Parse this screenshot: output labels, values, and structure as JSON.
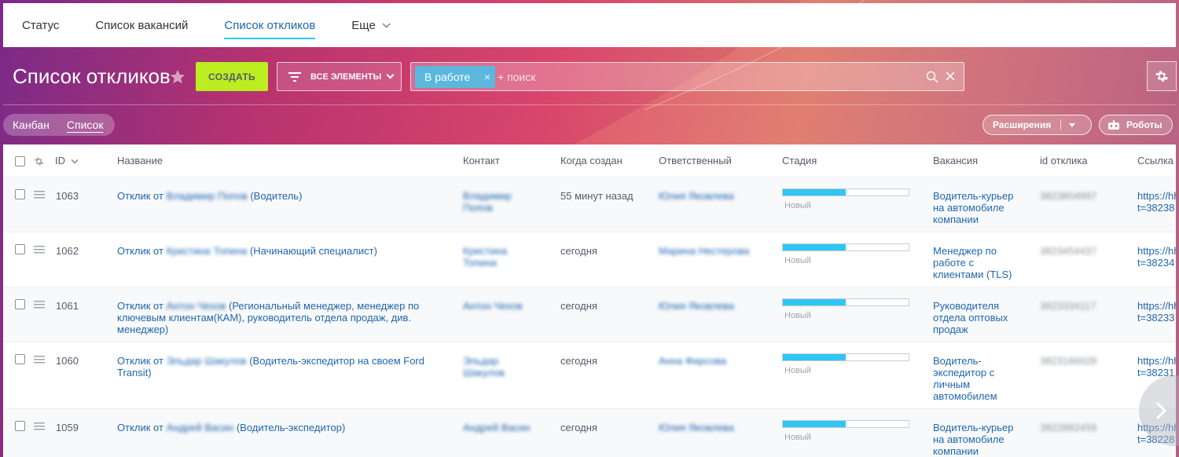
{
  "tabs": [
    {
      "label": "Статус"
    },
    {
      "label": "Список вакансий"
    },
    {
      "label": "Список откликов"
    },
    {
      "label": "Еще"
    }
  ],
  "page_title": "Список откликов",
  "toolbar": {
    "create_label": "СОЗДАТЬ",
    "filter_label": "ВСЕ ЭЛЕМЕНТЫ",
    "chip_label": "В работе",
    "chip_close": "×",
    "search_placeholder": "+ поиск"
  },
  "view_toggle": {
    "kanban": "Канбан",
    "list": "Список"
  },
  "extensions_label": "Расширения",
  "robots_label": "Роботы",
  "columns": {
    "id": "ID",
    "name": "Название",
    "contact": "Контакт",
    "created": "Когда создан",
    "responsible": "Ответственный",
    "stage": "Стадия",
    "vacancy": "Вакансия",
    "response_id": "id отклика",
    "link": "Ссылка"
  },
  "stage_progress_fraction": 0.5,
  "colors": {
    "accent": "#2fc6f6",
    "create": "#bbed21",
    "link": "#2067b0"
  },
  "rows": [
    {
      "id": "1063",
      "name_prefix": "Отклик от",
      "name_person": "Владимир Попов",
      "name_suffix": "(Водитель)",
      "contact_line1": "Владимир",
      "contact_line2": "Попов",
      "created": "55 минут назад",
      "responsible": "Юлия Яковлева",
      "stage": "Новый",
      "vacancy_lines": [
        "Водитель-курьер",
        "на автомобиле",
        "компании"
      ],
      "response_id": "3823804997",
      "link_line1": "https://hh",
      "link_line2": "t=38238"
    },
    {
      "id": "1062",
      "name_prefix": "Отклик от",
      "name_person": "Кристина Топина",
      "name_suffix": "(Начинающий специалист)",
      "contact_line1": "Кристина",
      "contact_line2": "Топина",
      "created": "сегодня",
      "responsible": "Марина Нестерова",
      "stage": "Новый",
      "vacancy_lines": [
        "Менеджер по",
        "работе с",
        "клиентами (TLS)"
      ],
      "response_id": "3823454437",
      "link_line1": "https://hh",
      "link_line2": "t=38234"
    },
    {
      "id": "1061",
      "name_prefix": "Отклик от",
      "name_person": "Антон Чехов",
      "name_suffix": "(Региональный менеджер, менеджер по",
      "name_line2": "ключевым клиентам(КАМ), руководитель отдела продаж, див.",
      "name_line3": "менеджер)",
      "contact_line1": "Антон Чехов",
      "contact_line2": "",
      "created": "сегодня",
      "responsible": "Юлия Яковлева",
      "stage": "Новый",
      "vacancy_lines": [
        "Руководителя",
        "отдела оптовых",
        "продаж"
      ],
      "response_id": "3823334117",
      "link_line1": "https://hh",
      "link_line2": "t=38233"
    },
    {
      "id": "1060",
      "name_prefix": "Отклик от",
      "name_person": "Эльдар Шакулов",
      "name_suffix": "(Водитель-экспедитор на своем Ford",
      "name_line2": "Transit)",
      "contact_line1": "Эльдар",
      "contact_line2": "Шакулов",
      "created": "сегодня",
      "responsible": "Анна Фирсова",
      "stage": "Новый",
      "vacancy_lines": [
        "Водитель-",
        "экспедитор с",
        "личным",
        "автомобилем"
      ],
      "response_id": "3823186928",
      "link_line1": "https://hh",
      "link_line2": "t=38231"
    },
    {
      "id": "1059",
      "name_prefix": "Отклик от",
      "name_person": "Андрей Васин",
      "name_suffix": "(Водитель-экспедитор)",
      "contact_line1": "Андрей Васин",
      "contact_line2": "",
      "created": "сегодня",
      "responsible": "Юлия Яковлева",
      "stage": "Новый",
      "vacancy_lines": [
        "Водитель-курьер",
        "на автомобиле",
        "компании"
      ],
      "response_id": "3822882459",
      "link_line1": "https://hh",
      "link_line2": "t=38228"
    }
  ]
}
